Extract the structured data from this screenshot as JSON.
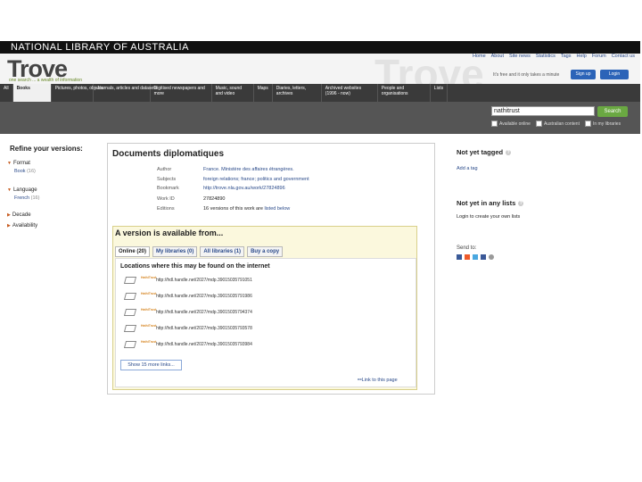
{
  "header": {
    "org": "NATIONAL LIBRARY OF AUSTRALIA",
    "logo": "Trove",
    "logo_sub": "one search ... a wealth of information",
    "watermark": "Trove",
    "top_links": [
      "Home",
      "About",
      "Site news",
      "Statistics",
      "Tags",
      "Help",
      "Forum",
      "Contact us"
    ],
    "promo": "It's free and it only takes a minute",
    "signup": "Sign up",
    "login": "Login"
  },
  "tabs": [
    {
      "label": "All"
    },
    {
      "label": "Books"
    },
    {
      "label": "Pictures, photos, objects"
    },
    {
      "label": "Journals, articles and datasets"
    },
    {
      "label": "Digitised newspapers and more"
    },
    {
      "label": "Music, sound and video"
    },
    {
      "label": "Maps"
    },
    {
      "label": "Diaries, letters, archives"
    },
    {
      "label": "Archived websites (1996 - now)"
    },
    {
      "label": "People and organisations"
    },
    {
      "label": "Lists"
    }
  ],
  "search": {
    "value": "nathitrust",
    "button": "Search",
    "options": [
      "Available online",
      "Australian content",
      "In my libraries"
    ]
  },
  "sidebar": {
    "title": "Refine your versions:",
    "facets": [
      {
        "label": "Format",
        "value": "Book",
        "count": "(16)"
      },
      {
        "label": "Language",
        "value": "French",
        "count": "(16)"
      },
      {
        "label": "Decade"
      },
      {
        "label": "Availability"
      }
    ]
  },
  "work": {
    "title": "Documents diplomatiques",
    "meta": [
      {
        "label": "Author",
        "value": "France. Ministère des affaires étrangères."
      },
      {
        "label": "Subjects",
        "value": "foreign relations; france; politics and government"
      },
      {
        "label": "Bookmark",
        "value": "http://trove.nla.gov.au/work/27824896"
      },
      {
        "label": "Work ID",
        "value": "27824890"
      },
      {
        "label": "Editions",
        "value": "16 versions of this work are",
        "link": "listed below"
      }
    ]
  },
  "versions": {
    "heading": "A version is available from...",
    "tabs": [
      "Online (20)",
      "My libraries (0)",
      "All libraries (1)",
      "Buy a copy"
    ],
    "locations_heading": "Locations where this may be found on the internet",
    "thumb_label": "HathiTrust",
    "links": [
      "http://hdl.handle.net/2027/mdp.39015035791051",
      "http://hdl.handle.net/2027/mdp.39015035791986",
      "http://hdl.handle.net/2027/mdp.39015035794374",
      "http://hdl.handle.net/2027/mdp.39015035793578",
      "http://hdl.handle.net/2027/mdp.39015035793984"
    ],
    "more_links": "Show 15 more links...",
    "link_page": "Link to this page"
  },
  "right": {
    "tagged_title": "Not yet tagged",
    "add_tag": "Add a tag",
    "lists_title": "Not yet in any lists",
    "lists_text": "Login to create your own lists",
    "send_to": "Send to:"
  },
  "colors": {
    "accent": "#2c64b8",
    "search_button": "#6aa842",
    "version_bg": "#fbf8dd"
  }
}
